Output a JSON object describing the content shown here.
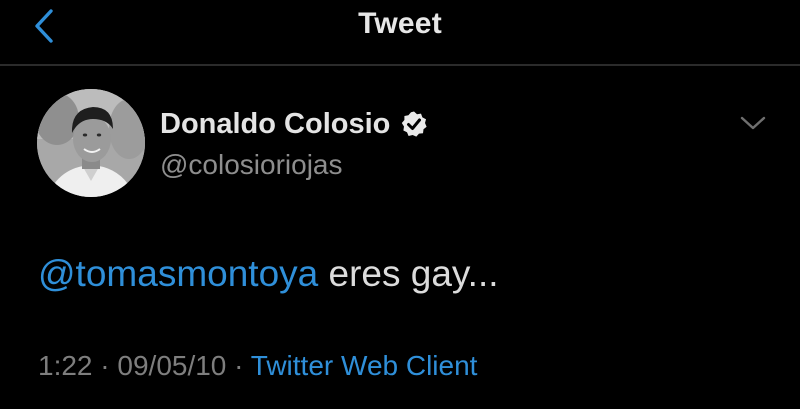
{
  "header": {
    "title": "Tweet",
    "back_icon": "chevron-left-icon"
  },
  "tweet": {
    "author": {
      "display_name": "Donaldo Colosio",
      "handle": "@colosioriojas",
      "verified": true,
      "verified_icon": "verified-badge-icon"
    },
    "menu_icon": "chevron-down-icon",
    "text": {
      "mention": "@tomasmontoya",
      "body": " eres gay..."
    },
    "meta": {
      "time": "1:22",
      "separator": " · ",
      "date": "09/05/10",
      "source": "Twitter Web Client"
    }
  },
  "colors": {
    "background": "#000000",
    "accent": "#2f8fd9",
    "primary_text": "#e4e4e4",
    "secondary_text": "#8e8e8e"
  }
}
